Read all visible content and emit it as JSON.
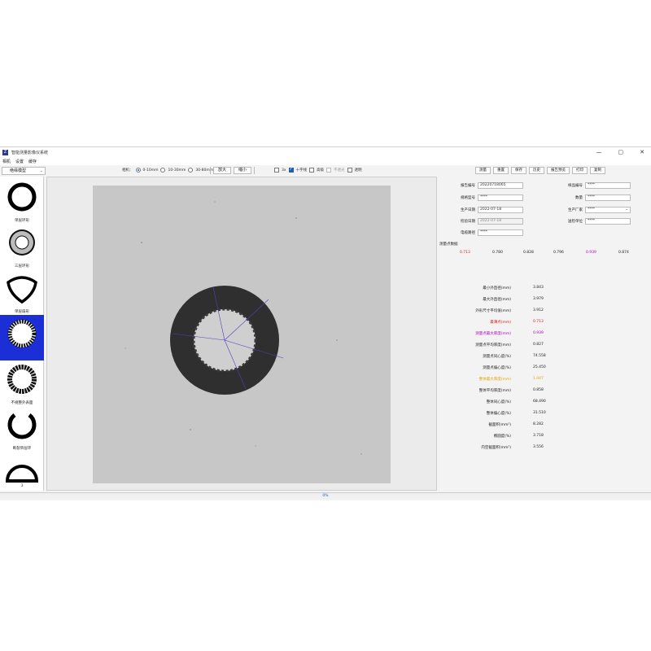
{
  "window": {
    "title": "智能测量影像仪系统",
    "icon_label": "Z",
    "controls": {
      "minimize": "—",
      "maximize": "▢",
      "close": "✕"
    }
  },
  "menu": [
    "相机",
    "设置",
    "缓存"
  ],
  "toolbar": {
    "model_select": "绝缘模型",
    "camera_label": "相机：",
    "camera_options": [
      {
        "label": "0-10mm",
        "selected": true
      },
      {
        "label": "10-30mm",
        "selected": false
      },
      {
        "label": "30-80mm",
        "selected": false
      }
    ],
    "zoom_in": "放大",
    "zoom_out": "缩小",
    "checks": [
      {
        "label": "3x",
        "checked": false,
        "disabled": false
      },
      {
        "label": "十字线",
        "checked": true,
        "disabled": false
      },
      {
        "label": "高级",
        "checked": false,
        "disabled": false
      },
      {
        "label": "不透光",
        "checked": false,
        "disabled": true
      },
      {
        "label": "透明",
        "checked": false,
        "disabled": false
      }
    ]
  },
  "sidebar": {
    "models": [
      {
        "label": "单层环形",
        "icon": "single-ring-icon",
        "selected": false
      },
      {
        "label": "三层环形",
        "icon": "triple-ring-icon",
        "selected": false
      },
      {
        "label": "单层扇形",
        "icon": "sector-icon",
        "selected": false
      },
      {
        "label": "",
        "icon": "rough-inner-ring-icon",
        "selected": true
      },
      {
        "label": "不规整外表面",
        "icon": "rough-outer-ring-icon",
        "selected": false
      },
      {
        "label": "断裂单层环",
        "icon": "broken-ring-icon",
        "selected": false
      },
      {
        "label": "",
        "icon": "half-circle-icon",
        "selected": false
      }
    ],
    "footer": "3"
  },
  "progress": {
    "text": "0%"
  },
  "right": {
    "tabs": [
      "测量",
      "重置",
      "保存",
      "历史",
      "报告预览",
      "打印",
      "复制"
    ],
    "fields_left": [
      {
        "label": "报告编号",
        "value": "20220718065",
        "readonly": false
      },
      {
        "label": "规格型号",
        "value": "****",
        "readonly": false
      },
      {
        "label": "生产日期",
        "value": "2022-07-18",
        "readonly": false
      },
      {
        "label": "检验日期",
        "value": "2022-07-18",
        "readonly": true
      },
      {
        "label": "电缆路径",
        "value": "****",
        "readonly": false
      }
    ],
    "fields_right": [
      {
        "label": "样品编号",
        "value": "****"
      },
      {
        "label": "数量",
        "value": "****"
      },
      {
        "label": "生产厂家",
        "value": "****",
        "dropdown": true
      },
      {
        "label": "送检单位",
        "value": "****"
      }
    ],
    "points_title": "测量点数据",
    "points": [
      {
        "v": "0.713",
        "color": "#d62020"
      },
      {
        "v": "0.780",
        "color": "#222222"
      },
      {
        "v": "0.828",
        "color": "#222222"
      },
      {
        "v": "0.796",
        "color": "#222222"
      },
      {
        "v": "0.939",
        "color": "#b000c0"
      },
      {
        "v": "0.874",
        "color": "#222222"
      }
    ],
    "results": [
      {
        "label": "最小外直径(mm)",
        "value": "3.843",
        "color": "#222222"
      },
      {
        "label": "最大外直径(mm)",
        "value": "3.979",
        "color": "#222222"
      },
      {
        "label": "外形尺寸平均值(mm)",
        "value": "3.912",
        "color": "#222222"
      },
      {
        "label": "最薄点(mm)",
        "value": "0.713",
        "color": "#d62020"
      },
      {
        "label": "测量点最大厚度(mm)",
        "value": "0.939",
        "color": "#b000c0"
      },
      {
        "label": "测量点平均厚度(mm)",
        "value": "0.827",
        "color": "#222222"
      },
      {
        "label": "测量点同心度(%)",
        "value": "74.558",
        "color": "#222222"
      },
      {
        "label": "测量点偏心度(%)",
        "value": "25.450",
        "color": "#222222"
      },
      {
        "label": "整体最大厚度(mm)",
        "value": "1.047",
        "color": "#e0a800"
      },
      {
        "label": "整体平均厚度(mm)",
        "value": "0.858",
        "color": "#222222"
      },
      {
        "label": "整体同心度(%)",
        "value": "68.490",
        "color": "#222222"
      },
      {
        "label": "整体偏心度(%)",
        "value": "31.510",
        "color": "#222222"
      },
      {
        "label": "截面积(mm²)",
        "value": "8.282",
        "color": "#222222"
      },
      {
        "label": "椭圆度(%)",
        "value": "3.718",
        "color": "#222222"
      },
      {
        "label": "内空截面积(mm²)",
        "value": "3.556",
        "color": "#222222"
      }
    ]
  },
  "colors": {
    "selected_model": "#1c2fd6",
    "accent": "#1a5fb4"
  }
}
